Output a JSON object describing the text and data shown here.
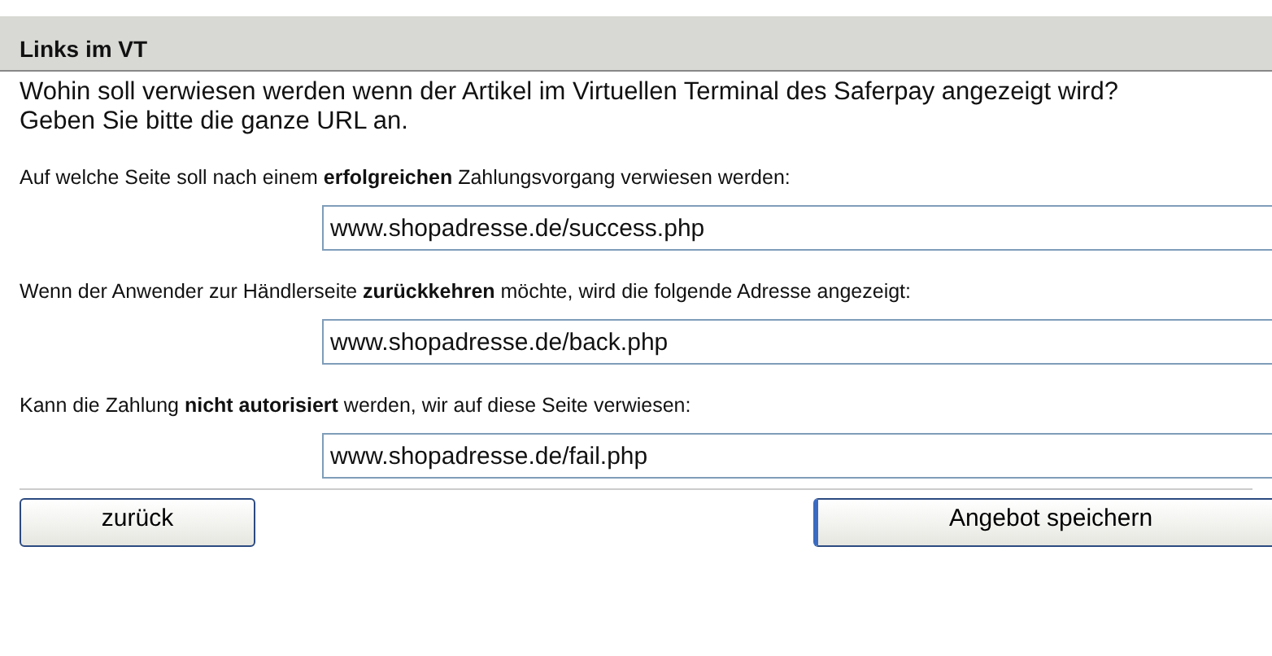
{
  "section": {
    "title": "Links im VT"
  },
  "intro": [
    "Wohin soll verwiesen werden wenn der Artikel im Virtuellen Terminal des Saferpay angezeigt wird?",
    "Geben Sie bitte die ganze URL an."
  ],
  "fields": [
    {
      "label": "Auf welche Seite soll nach einem **erfolgreichen** Zahlungsvorgang verwiesen werden:",
      "value": "www.shopadresse.de/success.php"
    },
    {
      "label": "Wenn der Anwender zur Händlerseite **zurückkehren** möchte, wird die folgende Adresse angezeigt:",
      "value": "www.shopadresse.de/back.php"
    },
    {
      "label": "Kann die Zahlung **nicht autorisiert** werden, wir auf diese Seite verwiesen:",
      "value": "www.shopadresse.de/fail.php"
    }
  ],
  "buttons": [
    {
      "label": "zurück",
      "kind": "plain"
    },
    {
      "label": "Angebot speichern",
      "kind": "primary"
    }
  ]
}
